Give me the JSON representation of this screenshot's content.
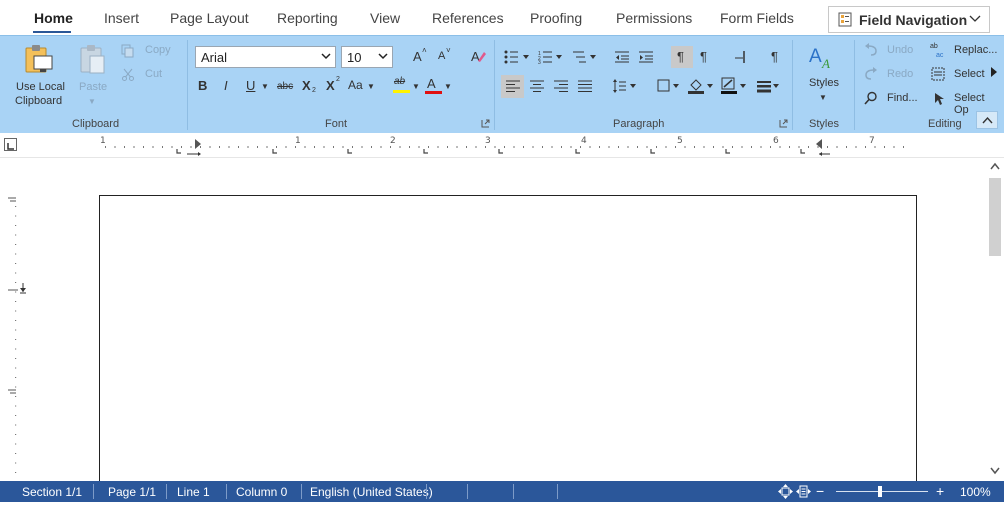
{
  "tabs": [
    "Home",
    "Insert",
    "Page Layout",
    "Reporting",
    "View",
    "References",
    "Proofing",
    "Permissions",
    "Form Fields"
  ],
  "active_tab": "Home",
  "field_navigation": {
    "label": "Field Navigation"
  },
  "clipboard": {
    "use_local_line1": "Use Local",
    "use_local_line2": "Clipboard",
    "paste": "Paste",
    "copy": "Copy",
    "cut": "Cut",
    "group_label": "Clipboard"
  },
  "font": {
    "family": "Arial",
    "size": "10",
    "bold": "B",
    "italic": "I",
    "underline": "U",
    "strike": "abc",
    "subscript": "X",
    "superscript": "X",
    "change_case": "Aa",
    "grow": "A",
    "shrink": "A",
    "highlight": "ab",
    "font_color": "A",
    "group_label": "Font"
  },
  "paragraph": {
    "group_label": "Paragraph"
  },
  "styles": {
    "label": "Styles",
    "group_label": "Styles"
  },
  "editing": {
    "undo": "Undo",
    "redo": "Redo",
    "find": "Find...",
    "replace": "Replac...",
    "select": "Select",
    "select_options": "Select Op",
    "group_label": "Editing"
  },
  "ruler_numbers": [
    "1",
    "1",
    "2",
    "3",
    "4",
    "5",
    "6",
    "7"
  ],
  "status": {
    "section": "Section 1/1",
    "page": "Page 1/1",
    "line": "Line 1",
    "column": "Column 0",
    "language": "English (United States)",
    "zoom": "100%",
    "zoom_minus": "−",
    "zoom_plus": "+"
  },
  "colors": {
    "ribbon": "#a9d3f5",
    "status_bar": "#2b579a",
    "accent": "#2b5797",
    "highlight_yellow": "#fff200",
    "font_color_red": "#e01010"
  },
  "zoom_level": 100
}
